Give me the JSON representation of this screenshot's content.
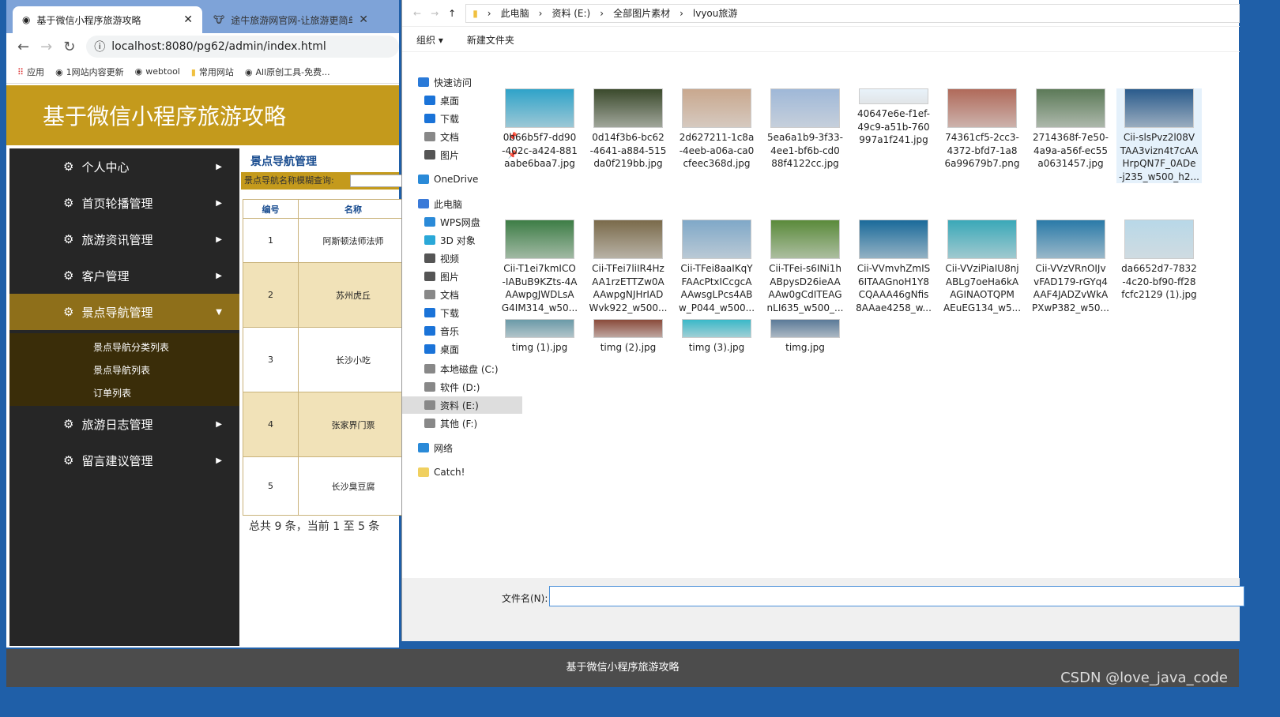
{
  "browser": {
    "tabs": [
      {
        "title": "基于微信小程序旅游攻略",
        "active": true
      },
      {
        "title": "途牛旅游网官网-让旅游更简单"
      }
    ],
    "url": "localhost:8080/pg62/admin/index.html",
    "bookmarks": [
      "应用",
      "1网站内容更新",
      "webtool",
      "常用网站",
      "All原创工具-免费..."
    ]
  },
  "app": {
    "title": "基于微信小程序旅游攻略",
    "accent": "#c49a1c",
    "sidebar": [
      {
        "label": "个人中心"
      },
      {
        "label": "首页轮播管理"
      },
      {
        "label": "旅游资讯管理"
      },
      {
        "label": "客户管理"
      },
      {
        "label": "景点导航管理",
        "expanded": true,
        "children": [
          "景点导航分类列表",
          "景点导航列表",
          "订单列表"
        ]
      },
      {
        "label": "旅游日志管理"
      },
      {
        "label": "留言建议管理"
      }
    ],
    "main": {
      "title": "景点导航管理",
      "search_label": "景点导航名称模糊查询:",
      "columns": [
        "编号",
        "名称"
      ],
      "rows": [
        [
          "1",
          "阿斯顿法师法师"
        ],
        [
          "2",
          "苏州虎丘"
        ],
        [
          "3",
          "长沙小吃"
        ],
        [
          "4",
          "张家界门票"
        ],
        [
          "5",
          "长沙臭豆腐"
        ]
      ],
      "pager": "总共 9 条，当前 1 至 5 条"
    },
    "footer": "基于微信小程序旅游攻略"
  },
  "dialog": {
    "path": [
      "此电脑",
      "资料 (E:)",
      "全部图片素材",
      "lvyou旅游"
    ],
    "toolbar": {
      "organize": "组织 ▾",
      "new_folder": "新建文件夹"
    },
    "nav": [
      {
        "label": "快速访问",
        "pinned": false
      },
      {
        "label": "桌面",
        "pinned": true
      },
      {
        "label": "下载",
        "pinned": true
      },
      {
        "label": "文档",
        "pinned": true
      },
      {
        "label": "图片",
        "pinned": true
      },
      {
        "label": "OneDrive"
      },
      {
        "label": "此电脑"
      },
      {
        "label": "WPS网盘"
      },
      {
        "label": "3D 对象"
      },
      {
        "label": "视频"
      },
      {
        "label": "图片"
      },
      {
        "label": "文档"
      },
      {
        "label": "下载"
      },
      {
        "label": "音乐"
      },
      {
        "label": "桌面"
      },
      {
        "label": "本地磁盘 (C:)"
      },
      {
        "label": "软件 (D:)"
      },
      {
        "label": "资料 (E:)",
        "selected": true
      },
      {
        "label": "其他 (F:)"
      },
      {
        "label": "网络"
      },
      {
        "label": "Catch!"
      }
    ],
    "files": [
      {
        "name": "0b66b5f7-dd90-402c-a424-881aabe6baa7.jpg",
        "lines": [
          "0b66b5f7-dd90",
          "-402c-a424-881",
          "aabe6baa7.jpg"
        ],
        "color": "#2fa3c9"
      },
      {
        "name": "0d14f3b6-bc62-4641-a884-515da0f219bb.jpg",
        "lines": [
          "0d14f3b6-bc62",
          "-4641-a884-515",
          "da0f219bb.jpg"
        ],
        "color": "#3b4a2c"
      },
      {
        "name": "2d627211-1c8a-4eeb-a06a-ca0cfeec368d.jpg",
        "lines": [
          "2d627211-1c8a",
          "-4eeb-a06a-ca0",
          "cfeec368d.jpg"
        ],
        "color": "#c9a88e"
      },
      {
        "name": "5ea6a1b9-3f33-4ee1-bf6b-cd088f4122cc.jpg",
        "lines": [
          "5ea6a1b9-3f33-",
          "4ee1-bf6b-cd0",
          "88f4122cc.jpg"
        ],
        "color": "#9fb8d8"
      },
      {
        "name": "40647e6e-f1ef-49c9-a51b-760997a1f241.jpg",
        "lines": [
          "40647e6e-f1ef-",
          "49c9-a51b-760",
          "997a1f241.jpg"
        ],
        "color": "#e8f2fa"
      },
      {
        "name": "74361cf5-2cc3-4372-bfd7-1a86a99679b7.png",
        "lines": [
          "74361cf5-2cc3-",
          "4372-bfd7-1a8",
          "6a99679b7.png"
        ],
        "color": "#b06a5a"
      },
      {
        "name": "2714368f-7e50-4a9a-a56f-ec55a0631457.jpg",
        "lines": [
          "2714368f-7e50-",
          "4a9a-a56f-ec55",
          "a0631457.jpg"
        ],
        "color": "#5c7a58"
      },
      {
        "name": "Cii-slsPv...",
        "lines": [
          "Cii-slsPvz2l08V",
          "TAA3vizn4t7cAA",
          "HrpQN7F_0ADe",
          "-j235_w500_h2..."
        ],
        "color": "#2a5b8c",
        "selected": true
      },
      {
        "name": "Cii-T1ei7kmICO...",
        "lines": [
          "Cii-T1ei7kmICO",
          "-IABuB9KZts-4A",
          "AAwpgJWDLsA",
          "G4IM314_w50..."
        ],
        "color": "#3d7d45"
      },
      {
        "name": "Cii-TFei7lilR4Hz...",
        "lines": [
          "Cii-TFei7liIR4Hz",
          "AA1rzETTZw0A",
          "AAwpgNJHrIAD",
          "Wvk922_w500..."
        ],
        "color": "#7a6a4a"
      },
      {
        "name": "Cii-TFei8aaIKqY...",
        "lines": [
          "Cii-TFei8aaIKqY",
          "FAAcPtxICcgcA",
          "AAwsgLPcs4AB",
          "w_P044_w500..."
        ],
        "color": "#7fa8c8"
      },
      {
        "name": "Cii-TFei-s6INi1h...",
        "lines": [
          "Cii-TFei-s6INi1h",
          "ABpysD26ieAA",
          "AAw0gCdITEAG",
          "nLI635_w500_..."
        ],
        "color": "#5a8a3a"
      },
      {
        "name": "Cii-VVmvhZmIS...",
        "lines": [
          "Cii-VVmvhZmIS",
          "6ITAAGnoH1Y8",
          "CQAAA46gNfis",
          "8AAae4258_w..."
        ],
        "color": "#1a6a9a"
      },
      {
        "name": "Cii-VVziPiaIU8nj...",
        "lines": [
          "Cii-VVziPiaIU8nj",
          "ABLg7oeHa6kA",
          "AGINAOTQPM",
          "AEuEG134_w5..."
        ],
        "color": "#3aa8b8"
      },
      {
        "name": "Cii-VVzVRnOIJv...",
        "lines": [
          "Cii-VVzVRnOIJv",
          "vFAD179-rGYq4",
          "AAF4JADZvWkA",
          "PXwP382_w50..."
        ],
        "color": "#2a7aa8"
      },
      {
        "name": "da6652d7-7832-4c20-bf90-ff28fcfc2129 (1).jpg",
        "lines": [
          "da6652d7-7832",
          "-4c20-bf90-ff28",
          "fcfc2129 (1).jpg"
        ],
        "color": "#b8d8e8"
      },
      {
        "name": "timg (1).jpg",
        "lines": [
          "timg (1).jpg"
        ],
        "color": "#6a9aa8"
      },
      {
        "name": "timg (2).jpg",
        "lines": [
          "timg (2).jpg"
        ],
        "color": "#8a4a3a"
      },
      {
        "name": "timg (3).jpg",
        "lines": [
          "timg (3).jpg"
        ],
        "color": "#3ab8c8"
      },
      {
        "name": "timg.jpg",
        "lines": [
          "timg.jpg"
        ],
        "color": "#5a7a98"
      }
    ],
    "filename_label": "文件名(N):",
    "filename_value": ""
  },
  "watermark": "CSDN @love_java_code"
}
